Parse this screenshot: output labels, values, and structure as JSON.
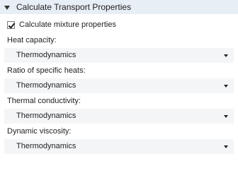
{
  "section": {
    "title": "Calculate Transport Properties",
    "expanded": true
  },
  "checkbox": {
    "label": "Calculate mixture properties",
    "checked": true
  },
  "fields": [
    {
      "label": "Heat capacity:",
      "value": "Thermodynamics"
    },
    {
      "label": "Ratio of specific heats:",
      "value": "Thermodynamics"
    },
    {
      "label": "Thermal conductivity:",
      "value": "Thermodynamics"
    },
    {
      "label": "Dynamic viscosity:",
      "value": "Thermodynamics"
    }
  ]
}
